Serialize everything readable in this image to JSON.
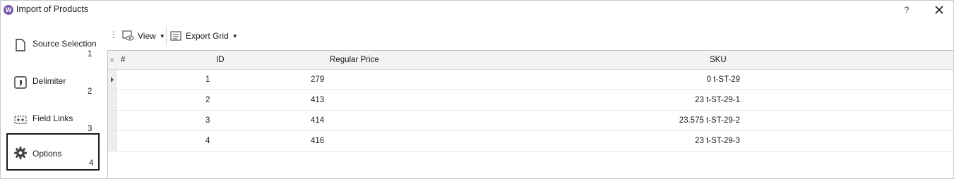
{
  "window": {
    "title": "Import of Products",
    "help": "?"
  },
  "sidebar": {
    "steps": [
      {
        "label": "Source Selection",
        "number": "1",
        "icon": "document-icon"
      },
      {
        "label": "Delimiter",
        "number": "2",
        "icon": "comma-icon"
      },
      {
        "label": "Field Links",
        "number": "3",
        "icon": "field-links-icon"
      },
      {
        "label": "Options",
        "number": "4",
        "icon": "gear-icon",
        "active": true
      }
    ]
  },
  "toolbar": {
    "view_label": "View",
    "export_label": "Export Grid"
  },
  "grid": {
    "columns": [
      "#",
      "ID",
      "Regular Price",
      "SKU"
    ],
    "rows": [
      {
        "id": "1",
        "price": "279",
        "sku": "0 t-ST-29"
      },
      {
        "id": "2",
        "price": "413",
        "sku": "23 t-ST-29-1"
      },
      {
        "id": "3",
        "price": "414",
        "sku": "23.575 t-ST-29-2"
      },
      {
        "id": "4",
        "price": "416",
        "sku": "23 t-ST-29-3"
      }
    ]
  }
}
